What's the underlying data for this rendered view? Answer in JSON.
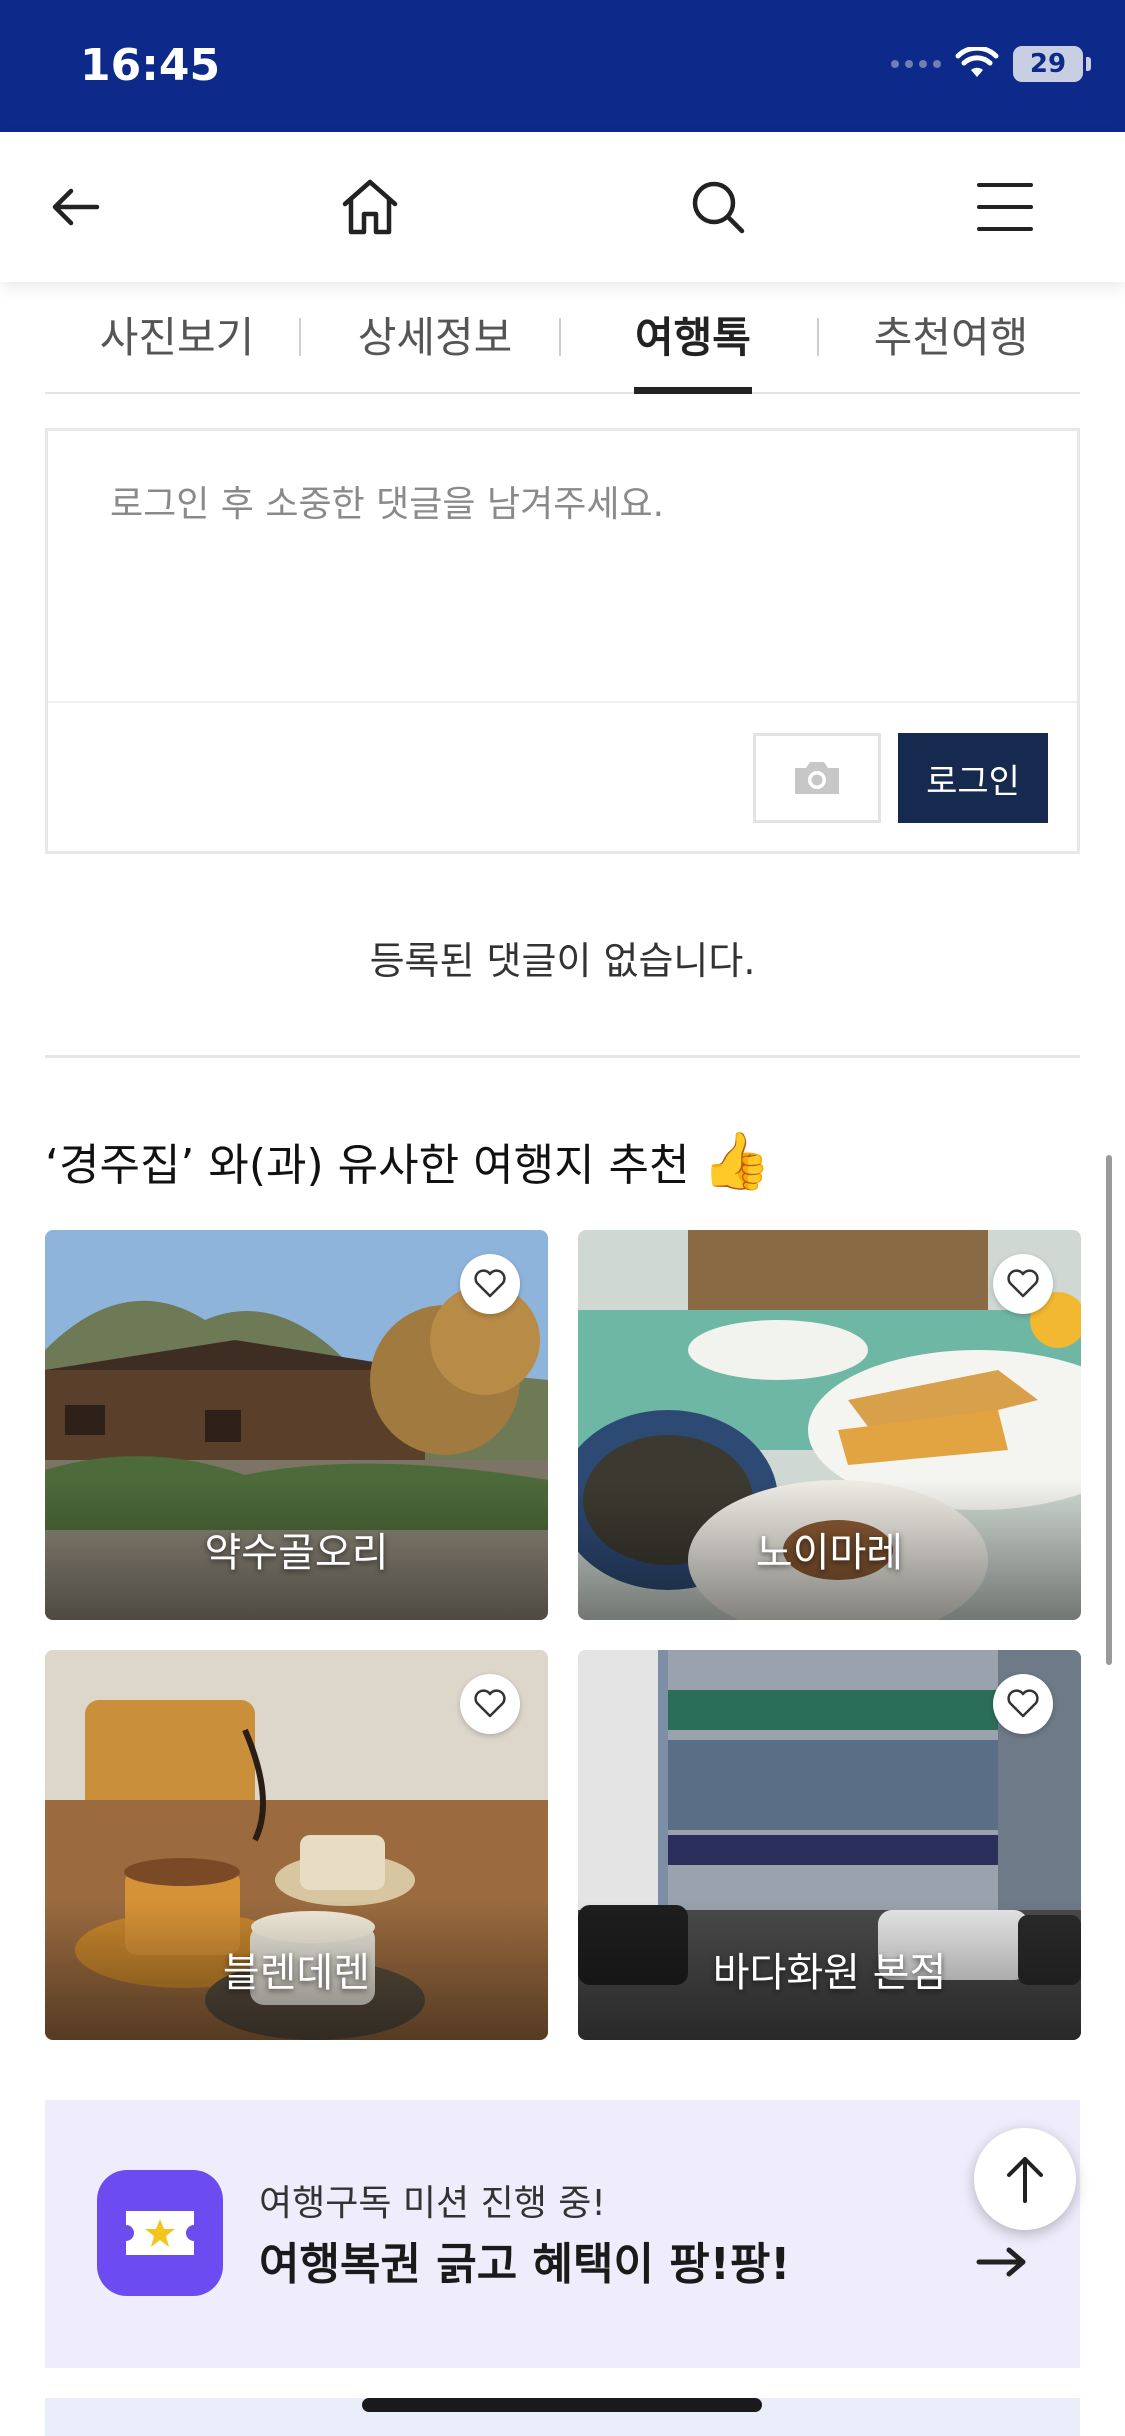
{
  "status": {
    "time": "16:45",
    "battery": "29"
  },
  "tabs": [
    {
      "label": "사진보기"
    },
    {
      "label": "상세정보"
    },
    {
      "label": "여행톡"
    },
    {
      "label": "추천여행"
    }
  ],
  "comment": {
    "placeholder": "로그인 후 소중한 댓글을 남겨주세요.",
    "login_label": "로그인",
    "empty_text": "등록된 댓글이 없습니다."
  },
  "recommend": {
    "title": "‘경주집’ 와(과) 유사한 여행지 추천",
    "cards": [
      {
        "label": "약수골오리"
      },
      {
        "label": "노이마레"
      },
      {
        "label": "블렌데렌"
      },
      {
        "label": "바다화원 본점"
      }
    ]
  },
  "banner": {
    "subtitle": "여행구독 미션 진행 중!",
    "title": "여행복권 긁고 혜택이 팡!팡!"
  },
  "colors": {
    "status_bar": "#0d2a8a",
    "login_button": "#162a4f",
    "banner_bg": "#efedfc",
    "banner_icon": "#6c4cf0"
  }
}
